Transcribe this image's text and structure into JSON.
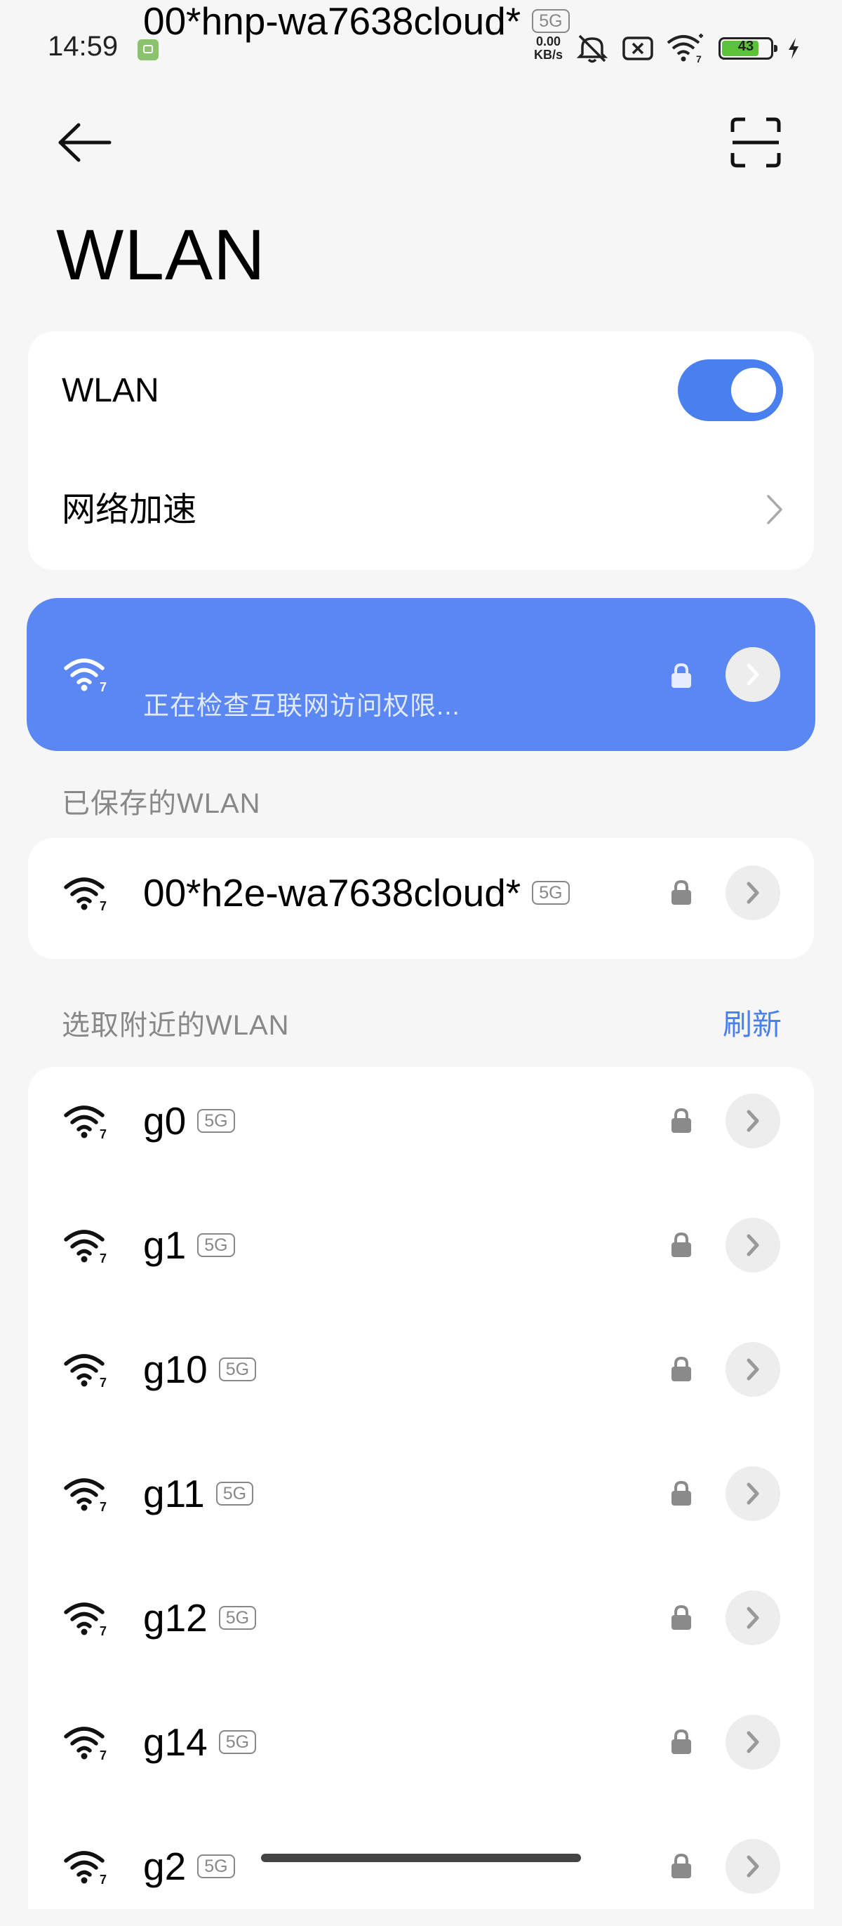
{
  "status_bar": {
    "time": "14:59",
    "net_speed_value": "0.00",
    "net_speed_unit": "KB/s",
    "battery_level": "43",
    "icons": [
      "app-notification-icon",
      "mute-icon",
      "sim-error-icon",
      "wifi-7-icon",
      "battery-icon",
      "charging-icon"
    ]
  },
  "header": {
    "back_icon": "back-arrow-icon",
    "scan_icon": "scan-qr-icon",
    "title": "WLAN"
  },
  "settings": {
    "wlan_label": "WLAN",
    "wlan_enabled": true,
    "accelerate_label": "网络加速"
  },
  "connected": {
    "ssid": "00*hnp-wa7638cloud*",
    "band": "5G",
    "status": "正在检查互联网访问权限..."
  },
  "saved": {
    "section_label": "已保存的WLAN",
    "networks": [
      {
        "ssid": "00*h2e-wa7638cloud*",
        "band": "5G"
      }
    ]
  },
  "nearby": {
    "section_label": "选取附近的WLAN",
    "refresh_label": "刷新",
    "networks": [
      {
        "ssid": "g0",
        "band": "5G"
      },
      {
        "ssid": "g1",
        "band": "5G"
      },
      {
        "ssid": "g10",
        "band": "5G"
      },
      {
        "ssid": "g11",
        "band": "5G"
      },
      {
        "ssid": "g12",
        "band": "5G"
      },
      {
        "ssid": "g14",
        "band": "5G"
      },
      {
        "ssid": "g2",
        "band": "5G"
      }
    ]
  },
  "colors": {
    "accent": "#4a7ff0",
    "connected_card": "#5a87f2",
    "background": "#f6f6f6"
  }
}
